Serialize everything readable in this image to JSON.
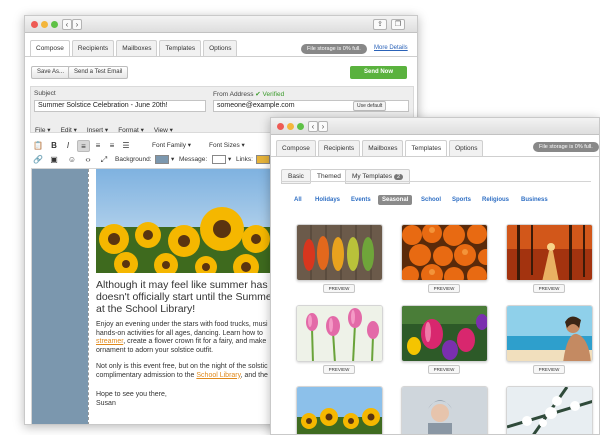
{
  "back_window": {
    "tabs": [
      "Compose",
      "Recipients",
      "Mailboxes",
      "Templates",
      "Options"
    ],
    "active_tab": "Compose",
    "storage_text": "File storage is 0% full.",
    "more_details": "More Details",
    "save_as": "Save As...",
    "send_test": "Send a Test Email",
    "send_now": "Send Now",
    "subject_label": "Subject",
    "subject_value": "Summer Solstice Celebration - June 20th!",
    "from_label": "From Address",
    "verified_label": "✔ Verified",
    "from_value": "someone@example.com",
    "use_default": "Use default",
    "menu": [
      "File",
      "Edit",
      "Insert",
      "Format",
      "View"
    ],
    "font_family": "Font Family",
    "font_sizes": "Font Sizes",
    "background_label": "Background:",
    "message_label": "Message:",
    "links_label": "Links:",
    "colors": {
      "background": "#7b97ae",
      "message": "#ffffff",
      "links": "#e6b33a"
    },
    "body": {
      "heading": [
        "Although it may feel like summer has arrived,",
        "doesn't officially start until the Summer Solst",
        "at the School Library!"
      ],
      "p1_line1": "Enjoy an evening under the stars with food trucks, musi",
      "p1_line2": "hands-on activities for all ages, dancing. Learn how to",
      "p1_link": "streamer",
      "p1_line3_rest": ", create a flower crown fit for a fairy, and make",
      "p1_line4": "ornament to adorn your solstice outfit.",
      "p2_line1": "Not only is this event free, but on the night of the solstic",
      "p2_line2_pre": "complimentary admission to the ",
      "p2_link": "School Library",
      "p2_line2_post": ", and the",
      "closing": "Hope to see you there,",
      "signature": "Susan"
    }
  },
  "front_window": {
    "tabs": [
      "Compose",
      "Recipients",
      "Mailboxes",
      "Templates",
      "Options"
    ],
    "active_tab": "Templates",
    "storage_text": "File storage is 0% full.",
    "sub_tabs": {
      "basic": "Basic",
      "themed": "Themed",
      "my_templates": "My Templates",
      "my_templates_count": "2"
    },
    "filters": [
      "All",
      "Holidays",
      "Events",
      "Seasonal",
      "School",
      "Sports",
      "Religious",
      "Business"
    ],
    "active_filter": "Seasonal",
    "preview_label": "PREVIEW"
  }
}
